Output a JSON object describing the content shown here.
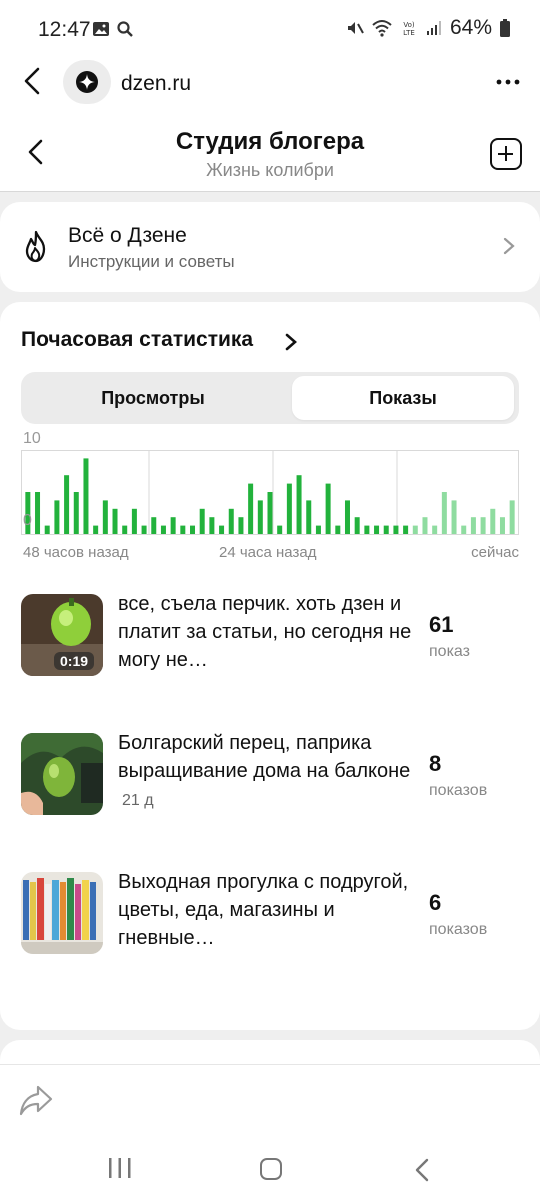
{
  "status_bar": {
    "time": "12:47",
    "battery": "64%",
    "network_label": "Vo) LTE"
  },
  "browser": {
    "url": "dzen.ru"
  },
  "header": {
    "title": "Студия блогера",
    "subtitle": "Жизнь колибри"
  },
  "about_card": {
    "title": "Всё о Дзене",
    "subtitle": "Инструкции и советы"
  },
  "stats": {
    "title": "Почасовая статистика",
    "tabs": [
      {
        "label": "Просмотры",
        "selected": false
      },
      {
        "label": "Показы",
        "selected": true
      }
    ]
  },
  "chart_data": {
    "type": "bar",
    "y_max_label": "10",
    "y_min_label": "0",
    "ylim": [
      0,
      10
    ],
    "x_labels": [
      "48 часов назад",
      "24 часа назад",
      "сейчас"
    ],
    "values": [
      5,
      5,
      1,
      4,
      7,
      5,
      9,
      1,
      4,
      3,
      1,
      3,
      1,
      2,
      1,
      2,
      1,
      1,
      3,
      2,
      1,
      3,
      2,
      6,
      4,
      5,
      1,
      6,
      7,
      4,
      1,
      6,
      1,
      4,
      2,
      1,
      1,
      1,
      1,
      1,
      1,
      2,
      1,
      5,
      4,
      1,
      2,
      2,
      3,
      2,
      4
    ],
    "recent_from_index": 40,
    "colors": {
      "bar": "#22b23c",
      "bar_recent": "#8fdca0",
      "grid": "#d9d9d9"
    },
    "grid": true
  },
  "items": [
    {
      "text": "все, съела перчик. хоть дзен и платит за статьи, но сегодня не могу не…",
      "duration": "0:19",
      "age": "",
      "count": "61",
      "count_label": "показ"
    },
    {
      "text": "Болгарский перец, паприка выращивание дома на балконе",
      "duration": "",
      "age": "21 д",
      "count": "8",
      "count_label": "показов"
    },
    {
      "text": "Выходная прогулка с подругой, цветы, еда, магазины и гневные…",
      "duration": "",
      "age": "",
      "count": "6",
      "count_label": "показов"
    }
  ],
  "icons": {
    "share": "share-icon",
    "back": "arrow-left-icon",
    "add": "plus-square-icon",
    "fire": "fire-icon",
    "more": "more-dots-icon"
  }
}
